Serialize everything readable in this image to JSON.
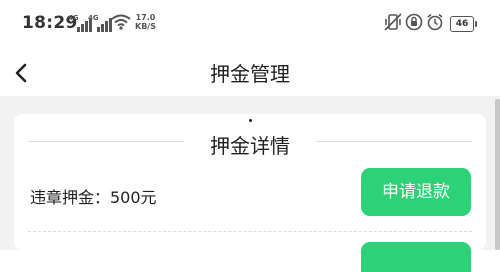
{
  "status_bar": {
    "time": "18:29",
    "signal_1_label": "4G",
    "signal_2_label": "4G",
    "speed_value": "17.0",
    "speed_unit": "KB/S",
    "battery": "46"
  },
  "nav": {
    "title": "押金管理",
    "back_icon": "chevron-left-icon"
  },
  "card": {
    "section_title": "押金详情",
    "deposit_label": "违章押金：500元",
    "refund_button_label": "申请退款"
  },
  "colors": {
    "accent": "#2dd177",
    "background": "#f2f2f2"
  }
}
